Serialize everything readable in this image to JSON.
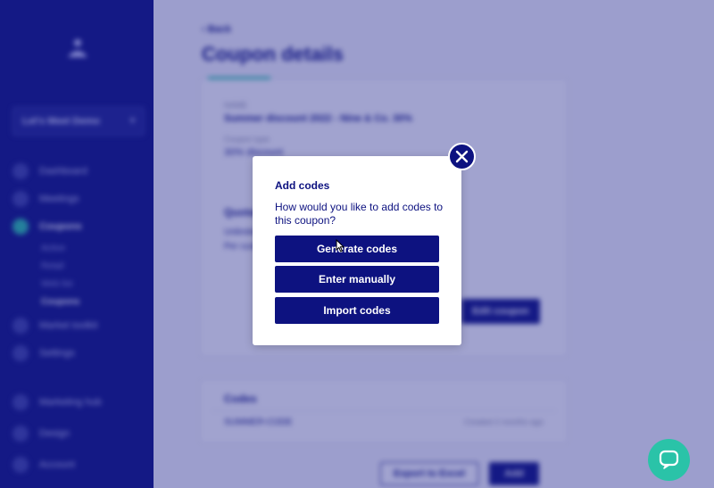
{
  "sidebar": {
    "brand_select": "Let's Meet Demo",
    "items": [
      "Dashboard",
      "Meetings",
      "Coupons"
    ],
    "sub_items": [
      "Active",
      "Retail",
      "Web list",
      "Coupons"
    ],
    "more_items": [
      "Market toolkit",
      "Settings"
    ],
    "bottom_items": [
      "Marketing hub",
      "Design",
      "Account"
    ]
  },
  "page": {
    "back_label": "Back",
    "title": "Coupon details"
  },
  "details": {
    "name_label": "NAME",
    "name_value": "Summer discount 2022 - Nine & Co. 30%",
    "type_label": "Coupon type",
    "type_value": "30% discount",
    "section_title": "Quotas",
    "quota_line1": "Unlimited",
    "quota_line2": "Per customer",
    "edit_button": "Edit coupon"
  },
  "codes_card": {
    "title": "Codes",
    "row_left": "SUMMER-CODE",
    "row_right": "Created 2 months ago",
    "export_button": "Export to Excel",
    "add_button": "Add"
  },
  "modal": {
    "title": "Add codes",
    "description": "How would you like to add codes to this coupon?",
    "buttons": {
      "generate": "Generate codes",
      "manual": "Enter manually",
      "import": "Import codes"
    }
  },
  "colors": {
    "navy": "#0d1280",
    "teal": "#2ac3a8",
    "overlay": "rgba(30,36,140,0.42)"
  },
  "icons": {
    "close": "close-icon",
    "help": "chat-bubble-icon",
    "cursor": "mouse-pointer-icon"
  }
}
